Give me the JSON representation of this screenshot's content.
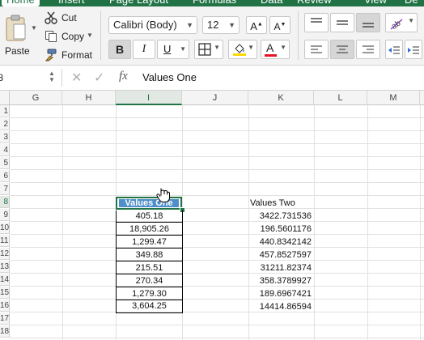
{
  "ribbon": {
    "tabs": [
      "Home",
      "Insert",
      "Page Layout",
      "Formulas",
      "Data",
      "Review",
      "View",
      "De"
    ],
    "clipboard": {
      "paste": "Paste",
      "cut": "Cut",
      "copy": "Copy",
      "format": "Format"
    },
    "font": {
      "name": "Calibri (Body)",
      "size": "12",
      "bold": "B",
      "italic": "I",
      "underline": "U",
      "font_color_glyph": "A"
    }
  },
  "formula_bar": {
    "name_box": "I8",
    "fx": "fx",
    "content": "Values One"
  },
  "sheet": {
    "columns": [
      "G",
      "H",
      "I",
      "J",
      "K",
      "L",
      "M"
    ],
    "selected_column": "I",
    "rows": [
      "1",
      "2",
      "3",
      "4",
      "5",
      "6",
      "7",
      "8",
      "9",
      "10",
      "11",
      "12",
      "13",
      "14",
      "15",
      "16",
      "17",
      "18"
    ],
    "selected_row": "8",
    "values_one_header": "Values One",
    "values_one": [
      "405.18",
      "18,905.26",
      "1,299.47",
      "349.88",
      "215.51",
      "270.34",
      "1,279.30",
      "3,604.25"
    ],
    "values_two_header": "Values Two",
    "values_two": [
      "3422.731536",
      "196.5601176",
      "440.8342142",
      "457.8527597",
      "31211.82374",
      "358.3789927",
      "189.6967421",
      "14414.86594"
    ]
  },
  "colors": {
    "accent": "#217346",
    "selected_header_fill": "#4f8fc9"
  },
  "icons": [
    "scissors-icon",
    "copy-icon",
    "format-painter-icon",
    "paste-icon",
    "grow-font-icon",
    "shrink-font-icon",
    "borders-icon",
    "fill-color-icon",
    "font-color-icon",
    "align-top-icon",
    "align-middle-icon",
    "align-bottom-icon",
    "orientation-icon",
    "align-left-icon",
    "align-center-icon",
    "align-right-icon",
    "decrease-indent-icon",
    "increase-indent-icon",
    "cancel-icon",
    "enter-icon",
    "hand-cursor-icon"
  ]
}
